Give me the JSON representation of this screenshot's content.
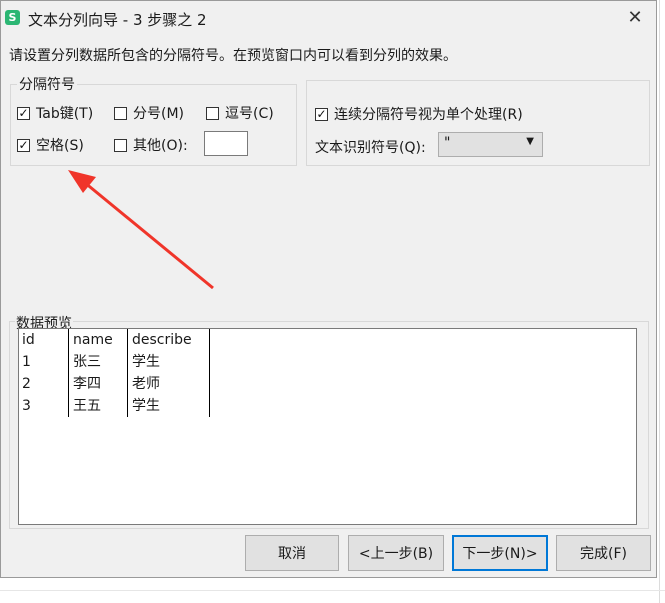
{
  "window": {
    "title": "文本分列向导 - 3 步骤之 2",
    "app_icon_letter": "S",
    "close_glyph": "✕"
  },
  "instruction": "请设置分列数据所包含的分隔符号。在预览窗口内可以看到分列的效果。",
  "delimiters": {
    "legend": "分隔符号",
    "tab": {
      "label": "Tab键(T)",
      "checked": true
    },
    "semicolon": {
      "label": "分号(M)",
      "checked": false
    },
    "comma": {
      "label": "逗号(C)",
      "checked": false
    },
    "space": {
      "label": "空格(S)",
      "checked": true
    },
    "other": {
      "label": "其他(O):",
      "checked": false,
      "value": ""
    }
  },
  "options": {
    "consecutive": {
      "label": "连续分隔符号视为单个处理(R)",
      "checked": true
    },
    "qualifier_label": "文本识别符号(Q):",
    "qualifier_value": "\""
  },
  "preview": {
    "legend": "数据预览",
    "columns": [
      [
        "id",
        "1",
        "2",
        "3"
      ],
      [
        "name",
        "张三",
        "李四",
        "王五"
      ],
      [
        "describe",
        "学生",
        "老师",
        "学生"
      ]
    ]
  },
  "buttons": {
    "cancel": "取消",
    "back": "<上一步(B)",
    "next": "下一步(N)>",
    "finish": "完成(F)"
  },
  "colors": {
    "annotation_arrow": "#f0352a",
    "default_button_border": "#0078d7",
    "app_icon": "#2bb673"
  }
}
